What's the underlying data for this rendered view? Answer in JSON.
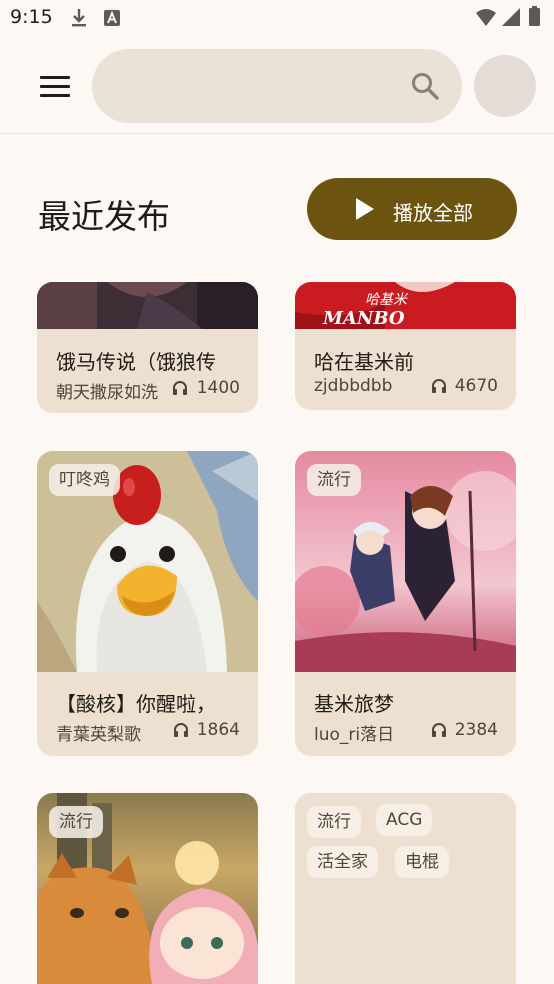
{
  "status_bar": {
    "time": "9:15",
    "icons": [
      "download-icon",
      "a-notification-icon",
      "wifi-icon",
      "signal-icon",
      "battery-icon"
    ]
  },
  "top_bar": {
    "menu_icon": "hamburger-menu-icon",
    "search": {
      "value": "",
      "placeholder": "",
      "icon": "search-icon"
    },
    "avatar": "avatar"
  },
  "section": {
    "title": "最近发布",
    "play_all_label": "播放全部",
    "play_icon": "play-icon"
  },
  "cards": [
    {
      "title": "饿马传说（饿狼传",
      "author": "朝天撒尿如洗",
      "plays": "1400",
      "tags": []
    },
    {
      "title": "哈在基米前",
      "author": "zjdbbdbb",
      "plays": "4670",
      "tags": [],
      "cover_text": "哈基米",
      "cover_subtext": "MANBO"
    },
    {
      "title": "【酸核】你醒啦，",
      "author": "青葉英梨歌",
      "plays": "1864",
      "tags": [
        "叮咚鸡"
      ]
    },
    {
      "title": "基米旅梦",
      "author": "luo_ri落日",
      "plays": "2384",
      "tags": [
        "流行"
      ]
    },
    {
      "title": "",
      "author": "",
      "plays": "",
      "tags": [
        "流行"
      ]
    },
    {
      "title": "",
      "author": "",
      "plays": "",
      "tags": [
        "流行",
        "ACG",
        "活全家",
        "电棍"
      ]
    }
  ],
  "colors": {
    "background": "#fdf8f3",
    "accent": "#6d5310",
    "card": "#ede0d1",
    "search": "#ebe2d7"
  }
}
